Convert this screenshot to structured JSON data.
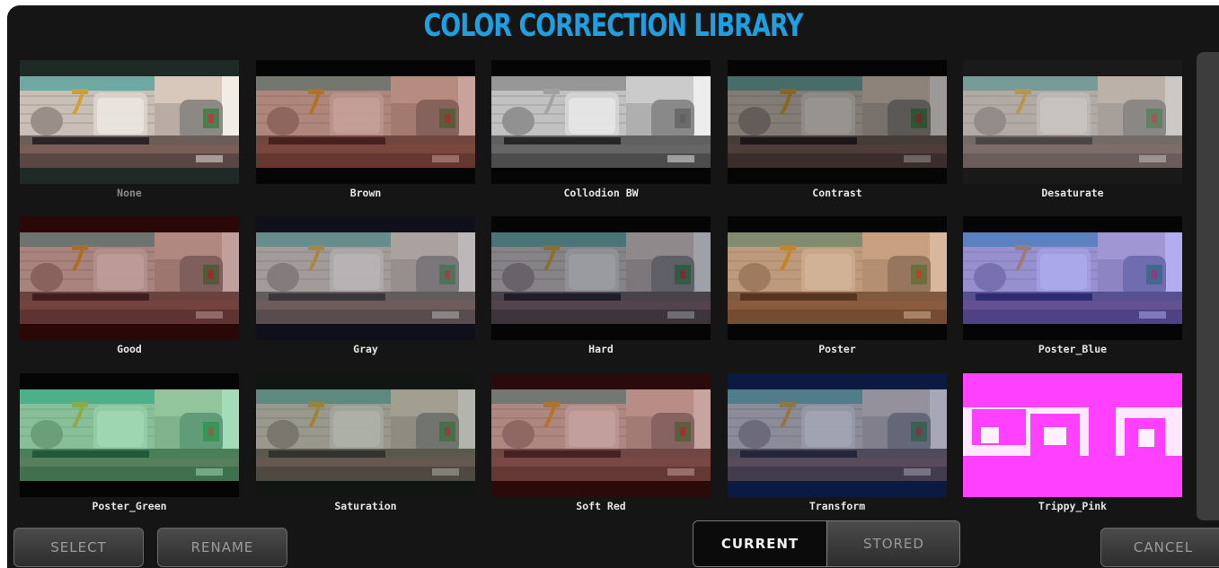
{
  "title": "COLOR CORRECTION LIBRARY",
  "presets": [
    {
      "label": "None",
      "tint": "none",
      "border": "#1e2a26",
      "dim": true
    },
    {
      "label": "Brown",
      "tint": "#7a1d10",
      "border": "#050505"
    },
    {
      "label": "Collodion BW",
      "tint": "gray",
      "border": "#050505"
    },
    {
      "label": "Contrast",
      "tint": "#000000",
      "border": "#050505"
    },
    {
      "label": "Desaturate",
      "tint": "#888888",
      "border": "#1a1a1a"
    },
    {
      "label": "Good",
      "tint": "#6a1010",
      "border": "#2a0808"
    },
    {
      "label": "Gray",
      "tint": "#5a5a66",
      "border": "#10101a"
    },
    {
      "label": "Hard",
      "tint": "#0a1430",
      "border": "#050505"
    },
    {
      "label": "Poster",
      "tint": "#a85510",
      "border": "#050505"
    },
    {
      "label": "Poster_Blue",
      "tint": "#3a3aff",
      "border": "#050505"
    },
    {
      "label": "Poster_Green",
      "tint": "#10c060",
      "border": "#050505"
    },
    {
      "label": "Saturation",
      "tint": "#405040",
      "border": "#121612"
    },
    {
      "label": "Soft Red",
      "tint": "#7a2020",
      "border": "#2a0a0a"
    },
    {
      "label": "Transform",
      "tint": "#1a2a60",
      "border": "#0a1a40"
    },
    {
      "label": "Trippy_Pink",
      "tint": "pink",
      "border": "#ff40ff"
    }
  ],
  "buttons": {
    "select": "SELECT",
    "rename": "RENAME",
    "cancel": "CANCEL"
  },
  "toggle": {
    "current": "CURRENT",
    "stored": "STORED",
    "selected": "CURRENT"
  },
  "colors": {
    "accent": "#1e9fe0",
    "background": "#151515"
  }
}
